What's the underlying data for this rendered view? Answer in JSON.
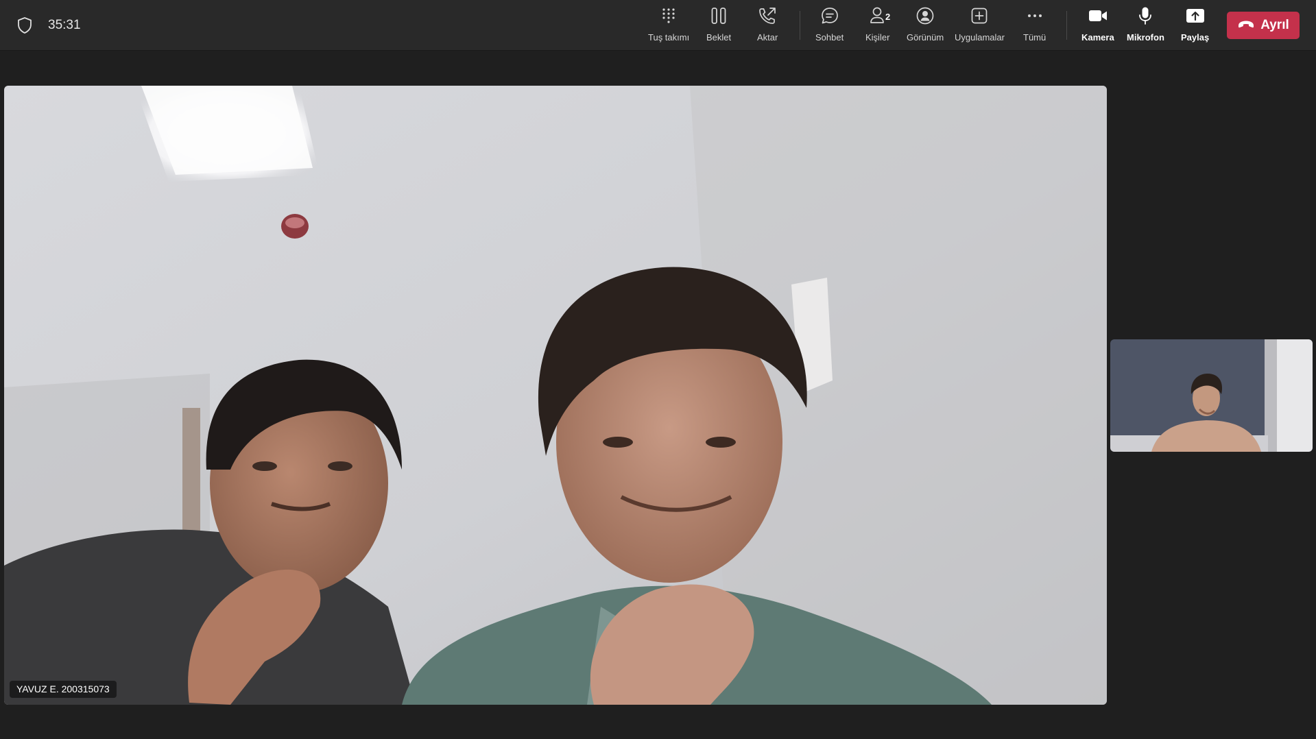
{
  "call": {
    "timer": "35:31"
  },
  "toolbar": {
    "dialpad_label": "Tuş takımı",
    "hold_label": "Beklet",
    "transfer_label": "Aktar",
    "chat_label": "Sohbet",
    "people_label": "Kişiler",
    "people_count": "2",
    "view_label": "Görünüm",
    "apps_label": "Uygulamalar",
    "more_label": "Tümü",
    "camera_label": "Kamera",
    "mic_label": "Mikrofon",
    "share_label": "Paylaş",
    "leave_label": "Ayrıl"
  },
  "main_video": {
    "participant_name": "YAVUZ E. 200315073"
  },
  "colors": {
    "leave_red": "#c4314b",
    "toolbar_bg": "#292929",
    "stage_bg": "#1f1f1f"
  },
  "icons": [
    "shield-icon",
    "dialpad-icon",
    "pause-icon",
    "phone-forward-icon",
    "chat-bubble-icon",
    "person-icon",
    "person-circle-icon",
    "plus-square-icon",
    "ellipsis-icon",
    "video-camera-icon",
    "microphone-icon",
    "share-tray-icon",
    "hang-up-icon"
  ]
}
